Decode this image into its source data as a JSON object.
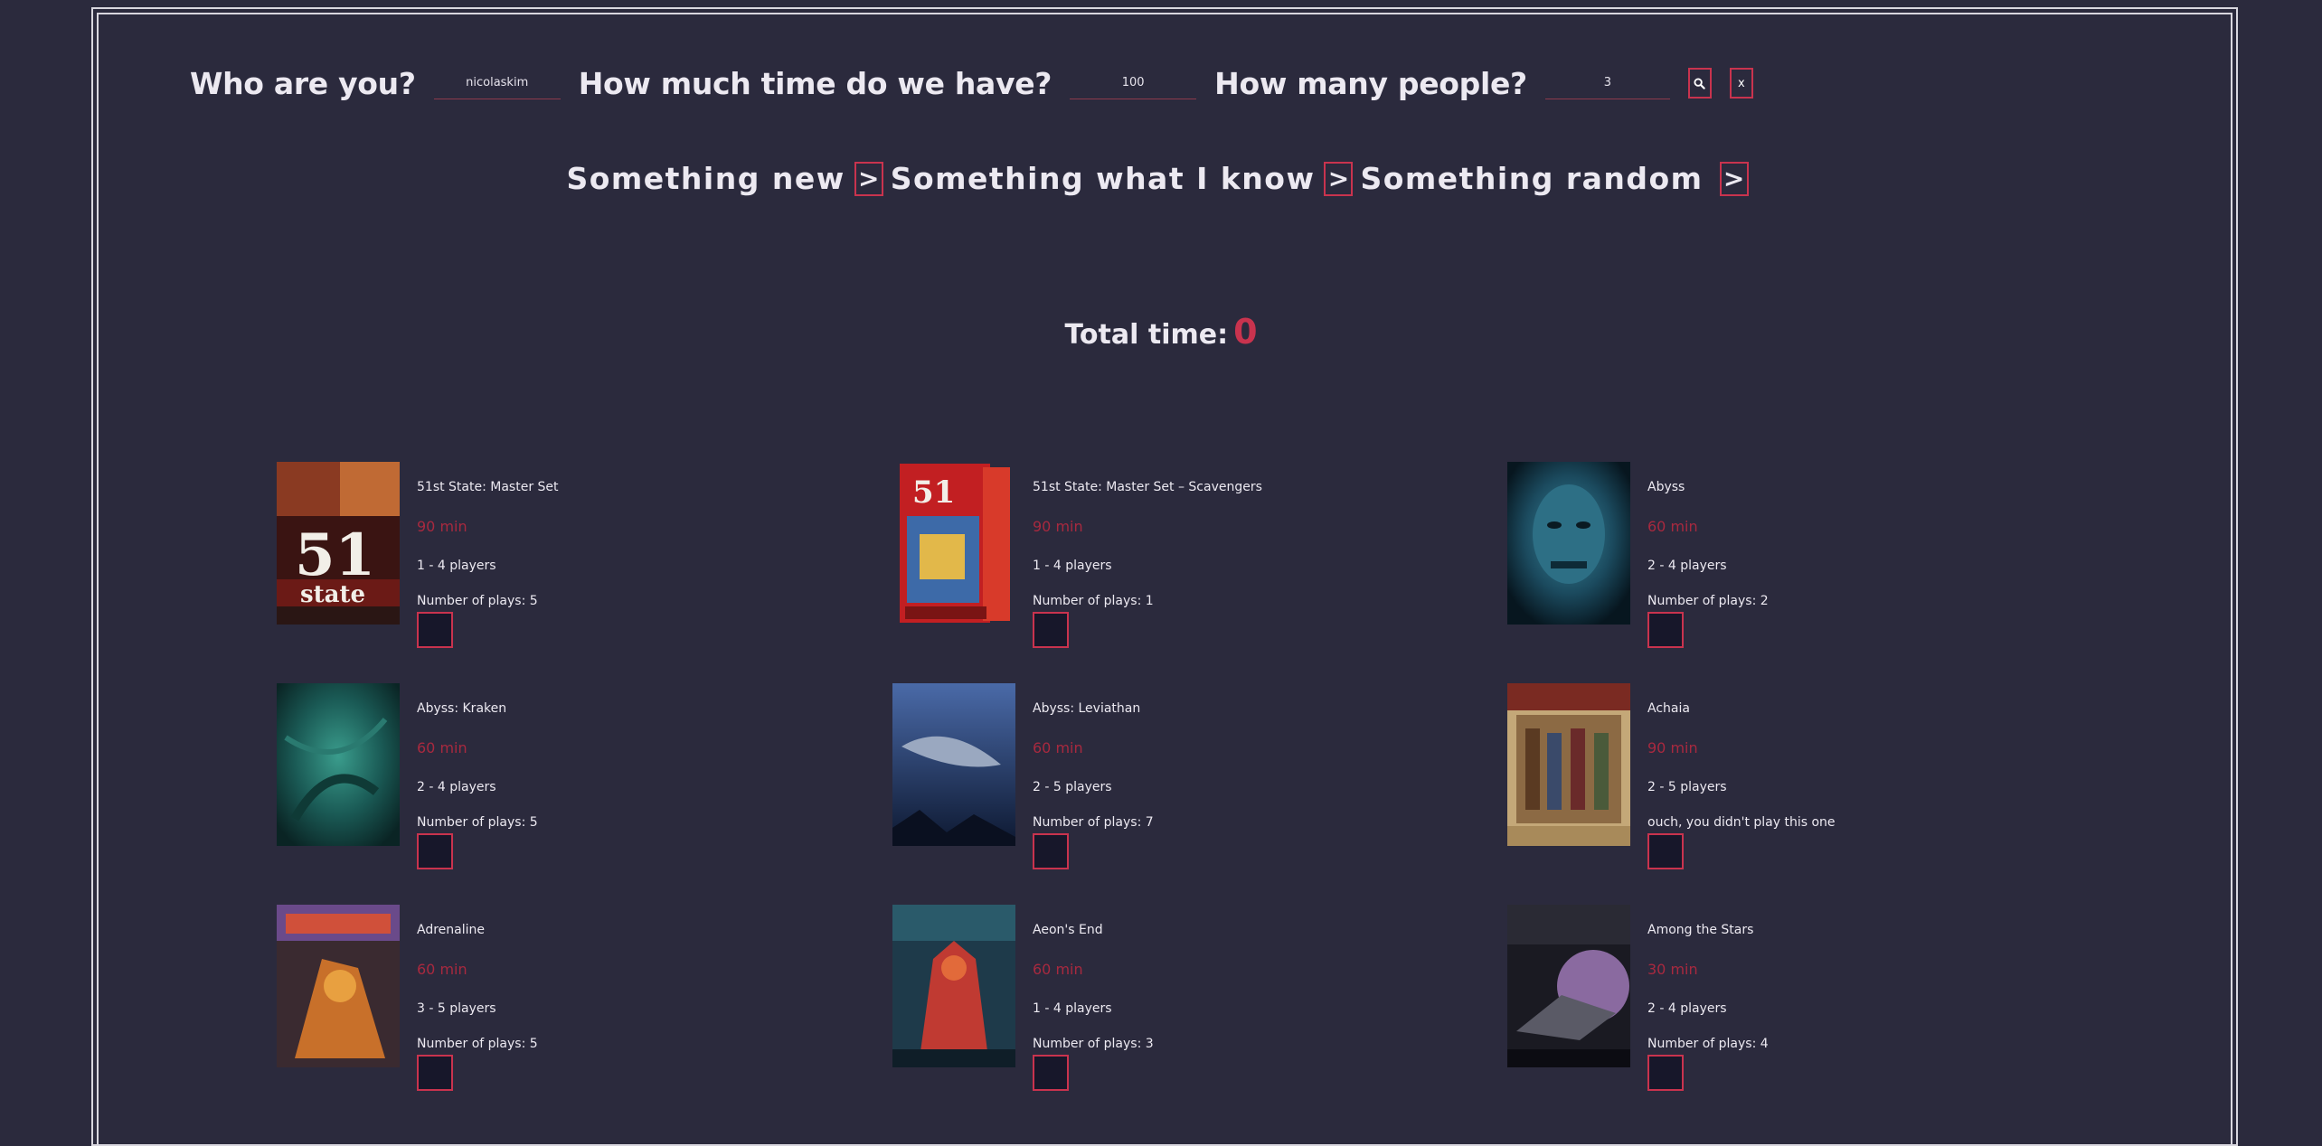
{
  "form": {
    "who_label": "Who are you?",
    "who_value": "nicolaskim",
    "time_label": "How much time do we have?",
    "time_value": "100",
    "people_label": "How many people?",
    "people_value": "3",
    "search_icon": "search-icon",
    "clear_label": "x"
  },
  "modes": [
    {
      "label": "Something new",
      "button": ">"
    },
    {
      "label": "Something what I know",
      "button": ">"
    },
    {
      "label": "Something random",
      "button": ">"
    }
  ],
  "total": {
    "label": "Total time:",
    "value": "0"
  },
  "colors": {
    "background": "#2b2a3d",
    "accent": "#c9334e",
    "time_text": "#a8293f",
    "checkbox_fill": "#17172a"
  },
  "games": [
    {
      "title": "51st State: Master Set",
      "time": "90 min",
      "players": "1 - 4 players",
      "plays": "Number of plays: 5"
    },
    {
      "title": "51st State: Master Set – Scavengers",
      "time": "90 min",
      "players": "1 - 4 players",
      "plays": "Number of plays: 1"
    },
    {
      "title": "Abyss",
      "time": "60 min",
      "players": "2 - 4 players",
      "plays": "Number of plays: 2"
    },
    {
      "title": "Abyss: Kraken",
      "time": "60 min",
      "players": "2 - 4 players",
      "plays": "Number of plays: 5"
    },
    {
      "title": "Abyss: Leviathan",
      "time": "60 min",
      "players": "2 - 5 players",
      "plays": "Number of plays: 7"
    },
    {
      "title": "Achaia",
      "time": "90 min",
      "players": "2 - 5 players",
      "plays": "ouch, you didn't play this one"
    },
    {
      "title": "Adrenaline",
      "time": "60 min",
      "players": "3 - 5 players",
      "plays": "Number of plays: 5"
    },
    {
      "title": "Aeon's End",
      "time": "60 min",
      "players": "1 - 4 players",
      "plays": "Number of plays: 3"
    },
    {
      "title": "Among the Stars",
      "time": "30 min",
      "players": "2 - 4 players",
      "plays": "Number of plays: 4"
    }
  ]
}
